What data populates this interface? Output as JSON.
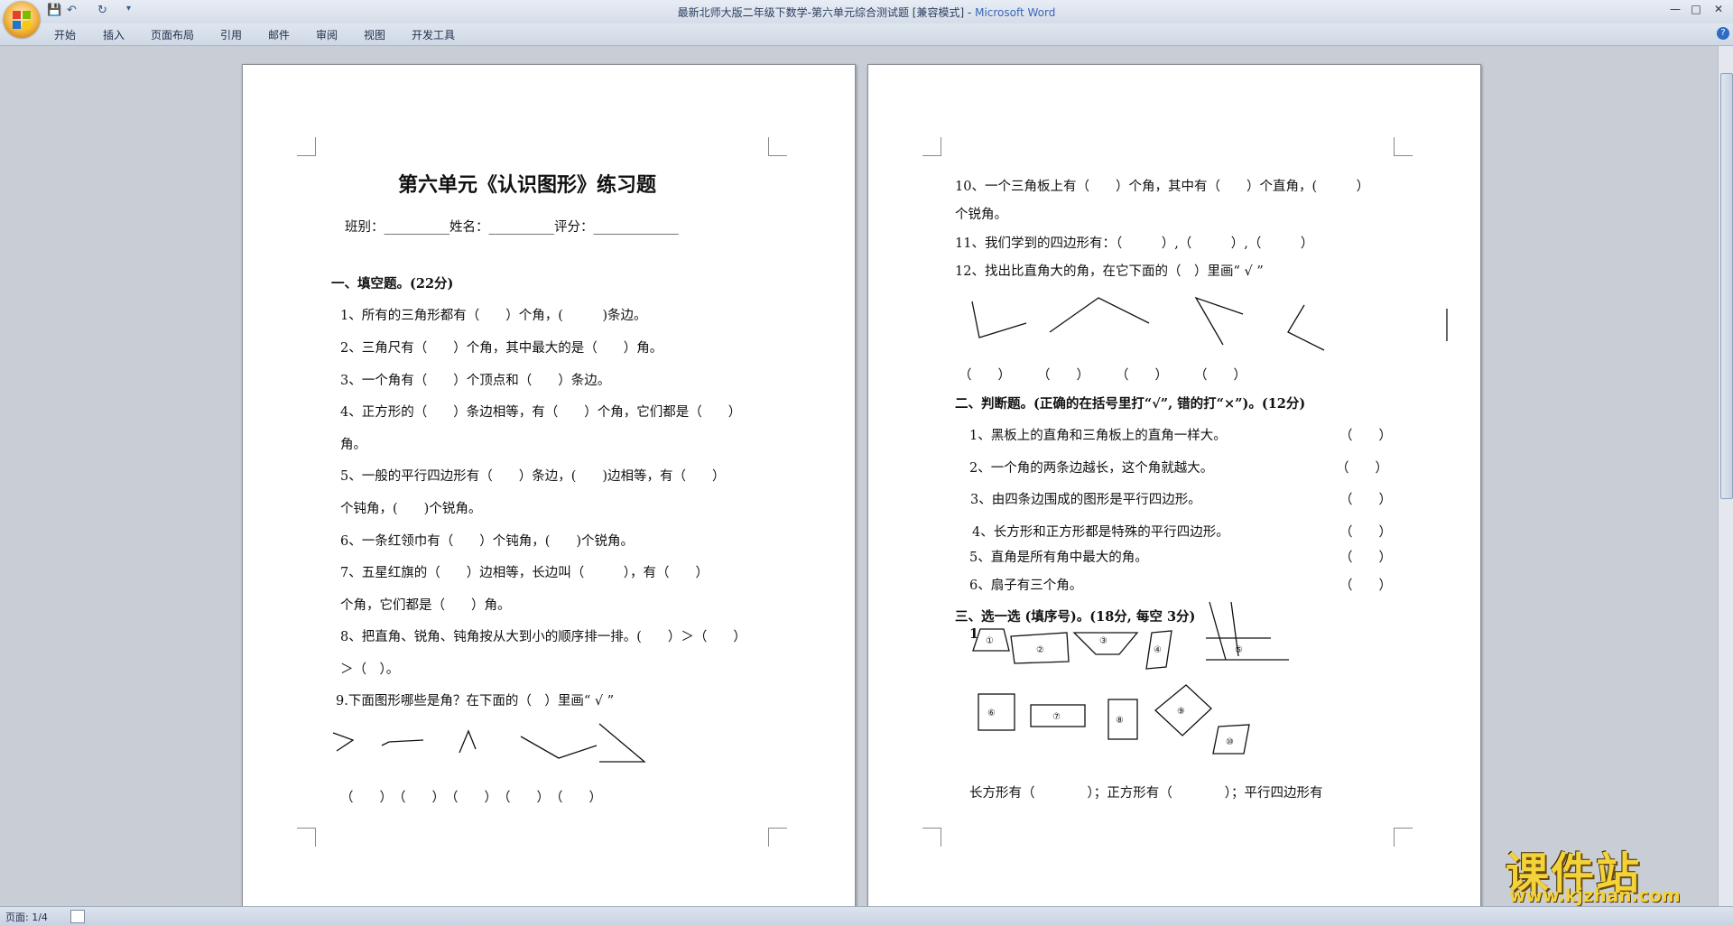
{
  "window": {
    "title": "最新北师大版二年级下数学-第六单元综合测试题 [兼容模式] - ",
    "app_name": "Microsoft Word",
    "controls": [
      "—",
      "□",
      "✕"
    ]
  },
  "quick_access": {
    "save_icon": "save-icon",
    "undo_icon": "undo-icon",
    "redo_icon": "redo-icon",
    "more": "▾"
  },
  "ribbon": {
    "tabs": [
      "开始",
      "插入",
      "页面布局",
      "引用",
      "邮件",
      "审阅",
      "视图",
      "开发工具"
    ],
    "help": "?"
  },
  "page1": {
    "title": "第六单元《认识图形》练习题",
    "class_line": "班别：__________姓名：__________评分：_____________",
    "section1": "一、填空题。(22分)",
    "q1": "1、所有的三角形都有（　　）个角，(　　　)条边。",
    "q2": "2、三角尺有（　　）个角，其中最大的是（　　）角。",
    "q3": "3、一个角有（　　）个顶点和（　　）条边。",
    "q4a": "4、正方形的（　　）条边相等，有（　　）个角，它们都是（　　）",
    "q4b": "角。",
    "q5a": "5、一般的平行四边形有（　　）条边，(　　)边相等，有（　　）",
    "q5b": "个钝角，(　　)个锐角。",
    "q6": "6、一条红领巾有（　　）个钝角，(　　)个锐角。",
    "q7a": "7、五星红旗的（　　）边相等，长边叫（　　　），有（　　）",
    "q7b": "个角，它们都是（　　）角。",
    "q8a": "8、把直角、锐角、钝角按从大到小的顺序排一排。(　　）＞（　　）",
    "q8b": "＞（　）。",
    "q9": "9.下面图形哪些是角？在下面的（　）里画“ √ ”",
    "q9_answers": "（　　）　（　　）　（　　）　（　　）　（　　）"
  },
  "page2": {
    "q10a": "10、一个三角板上有（　　）个角，其中有（　　）个直角，(　　　）",
    "q10b": "个锐角。",
    "q11": "11、我们学到的四边形有：（　　　）,（　　　）,（　　　）",
    "q12": "12、找出比直角大的角，在它下面的（　）里画“ √ ”",
    "q12_answers": "（　　）　　　（　　）　　　（　　）　　　（　　）",
    "section2": "二、判断题。(正确的在括号里打“√”, 错的打“×”)。(12分)",
    "j1": "1、黑板上的直角和三角板上的直角一样大。",
    "j2": "2、一个角的两条边越长，这个角就越大。",
    "j3": "3、由四条边围成的图形是平行四边形。",
    "j4": "4、长方形和正方形都是特殊的平行四边形。",
    "j5": "5、直角是所有角中最大的角。",
    "j6": "6、扇子有三个角。",
    "paren": "（　　）",
    "section3": "三、选一选 (填序号)。(18分, 每空 3分)",
    "s3_num": "1",
    "shape_labels": [
      "①",
      "②",
      "③",
      "④",
      "⑤",
      "⑥",
      "⑦",
      "⑧",
      "⑨",
      "⑩"
    ],
    "s3_answer": "长方形有（　　　　）；正方形有（　　　　）；平行四边形有"
  },
  "statusbar": {
    "page": "页面: 1/4"
  },
  "watermark": {
    "brand": "课件站",
    "url": "www.kjzhan.com"
  }
}
